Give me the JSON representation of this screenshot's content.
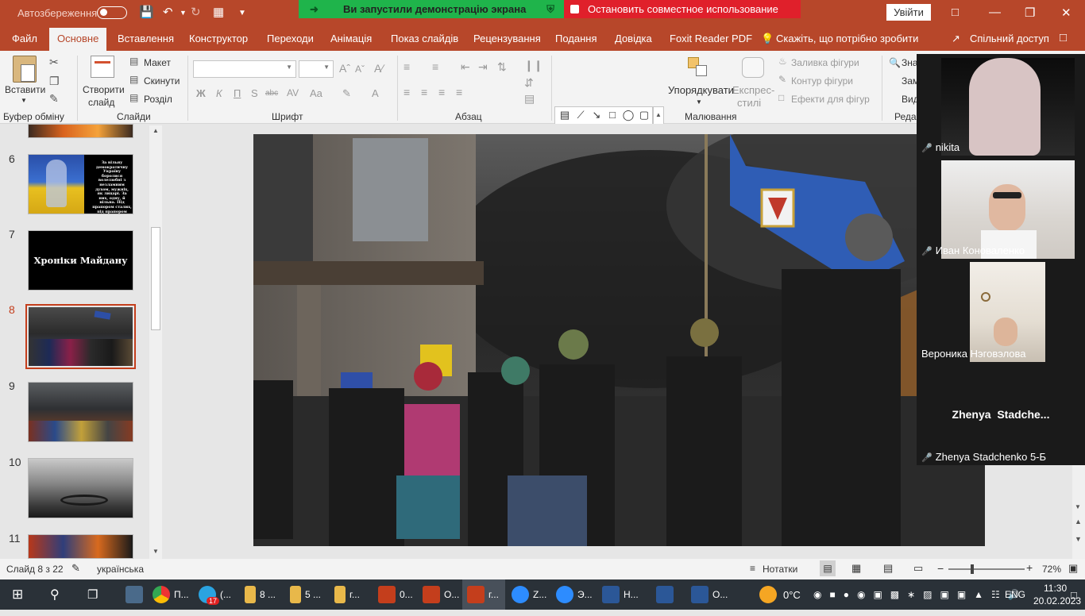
{
  "titlebar": {
    "autosave": "Автозбереження",
    "share_status": "Ви запустили демонстрацію экрана",
    "stop_share": "Остановить совместное использование",
    "signin": "Увійти"
  },
  "menu": {
    "items": [
      "Файл",
      "Основне",
      "Вставлення",
      "Конструктор",
      "Переходи",
      "Анімація",
      "Показ слайдів",
      "Рецензування",
      "Подання",
      "Довідка",
      "Foxit Reader PDF"
    ],
    "tell_me": "Скажіть, що потрібно зробити",
    "share": "Спільний доступ"
  },
  "ribbon": {
    "paste": "Вставити",
    "clipboard": "Буфер обміну",
    "new_slide": "Створити",
    "new_slide2": "слайд",
    "layout": "Макет",
    "reset": "Скинути",
    "section": "Розділ",
    "slides_group": "Слайди",
    "font_group": "Шрифт",
    "paragraph_group": "Абзац",
    "arrange": "Упорядкувати",
    "quick_styles": "Експрес-",
    "quick_styles2": "стилі",
    "shape_fill": "Заливка фігури",
    "shape_outline": "Контур фігури",
    "shape_effects": "Ефекти для фігур",
    "drawing_group": "Малювання",
    "find": "Зна",
    "replace": "Зам",
    "select": "Вид",
    "editing_group": "Редаг",
    "bold": "Ж",
    "italic": "К",
    "underline": "П",
    "strike": "abc"
  },
  "thumbnails": {
    "slide6_text": "За вільну демократичну Україну боролися волелюбні з незламним духом, мужніх, як лицарі. За них, одну, й вільна. Під прапором сталих, під прапором сміливих",
    "slide7_text": "Хроніки Майдану",
    "numbers": [
      "6",
      "7",
      "8",
      "9",
      "10",
      "11"
    ]
  },
  "participants": [
    {
      "name": "nikita"
    },
    {
      "name": "Иван Коноваленко"
    },
    {
      "name": "Вероника Нэговэлова"
    },
    {
      "name": "Zhenya Stadchenko 5-Б",
      "display": "Zhenya  Stadche..."
    }
  ],
  "status": {
    "slide": "Слайд 8 з 22",
    "language": "українська",
    "notes": "Нотатки",
    "zoom": "72%"
  },
  "taskbar": {
    "temp": "0°C",
    "lang": "ENG",
    "time": "11:30",
    "date": "20.02.2023",
    "badge": "17",
    "items": [
      "П...",
      "(...",
      "8 ...",
      "5 ...",
      "г...",
      "0...",
      "О...",
      "г...",
      "Z...",
      "Э...",
      "Н...",
      "",
      "О..."
    ]
  }
}
